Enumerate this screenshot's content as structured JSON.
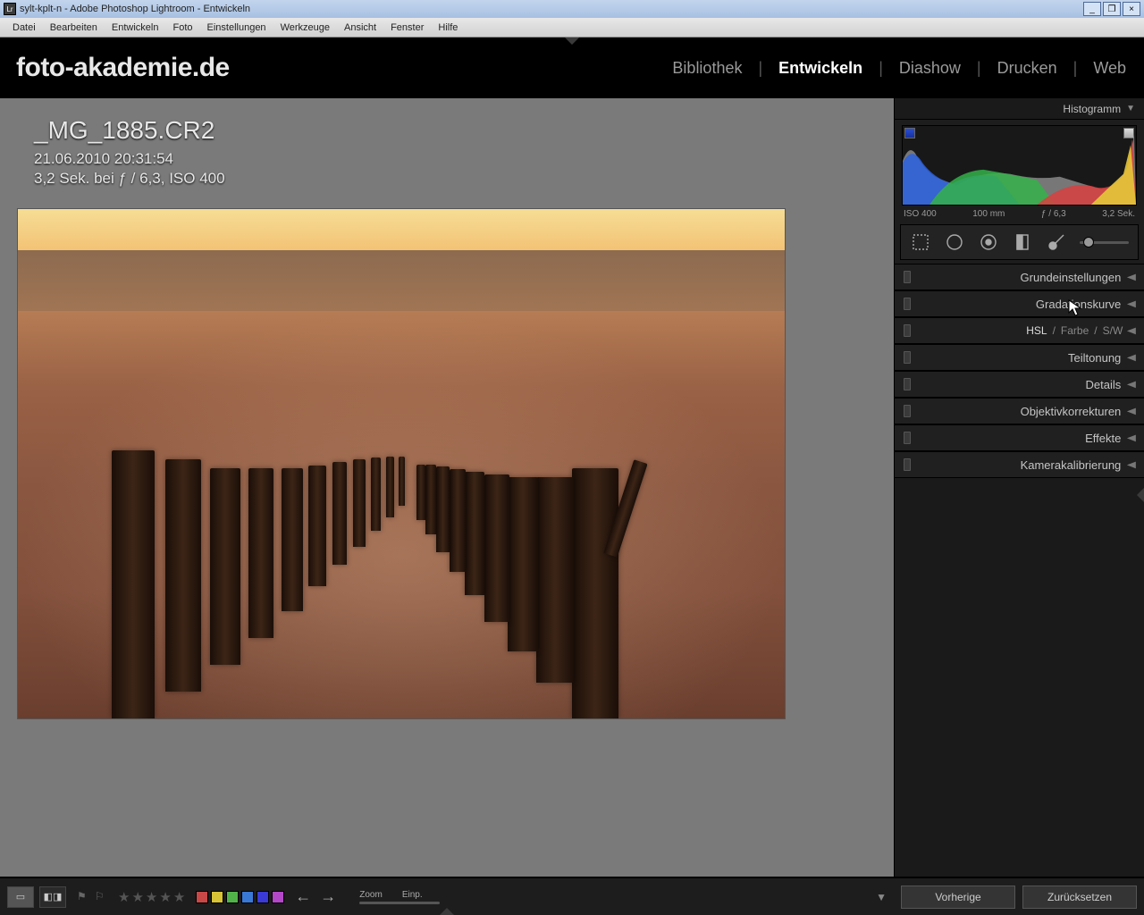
{
  "window": {
    "title": "sylt-kplt-n - Adobe Photoshop Lightroom - Entwickeln"
  },
  "menu": [
    "Datei",
    "Bearbeiten",
    "Entwickeln",
    "Foto",
    "Einstellungen",
    "Werkzeuge",
    "Ansicht",
    "Fenster",
    "Hilfe"
  ],
  "identity": "foto-akademie.de",
  "modules": {
    "items": [
      "Bibliothek",
      "Entwickeln",
      "Diashow",
      "Drucken",
      "Web"
    ],
    "active": "Entwickeln"
  },
  "image_info": {
    "filename": "_MG_1885.CR2",
    "datetime": "21.06.2010 20:31:54",
    "exposure": "3,2 Sek. bei ƒ / 6,3, ISO 400"
  },
  "histogram": {
    "title": "Histogramm",
    "iso": "ISO 400",
    "focal": "100 mm",
    "aperture": "ƒ / 6,3",
    "shutter": "3,2 Sek."
  },
  "panels": {
    "basic": "Grundeinstellungen",
    "tone": "Gradationskurve",
    "hsl": {
      "hsl": "HSL",
      "farbe": "Farbe",
      "sw": "S/W"
    },
    "split": "Teiltonung",
    "detail": "Details",
    "lens": "Objektivkorrekturen",
    "effects": "Effekte",
    "calib": "Kamerakalibrierung"
  },
  "toolbar": {
    "zoom": "Zoom",
    "einp": "Einp."
  },
  "buttons": {
    "previous": "Vorherige",
    "reset": "Zurücksetzen"
  },
  "colors": {
    "chips": [
      "#c84848",
      "#d8c236",
      "#52b24a",
      "#3a78d6",
      "#3a3ad6",
      "#b248c8"
    ]
  }
}
